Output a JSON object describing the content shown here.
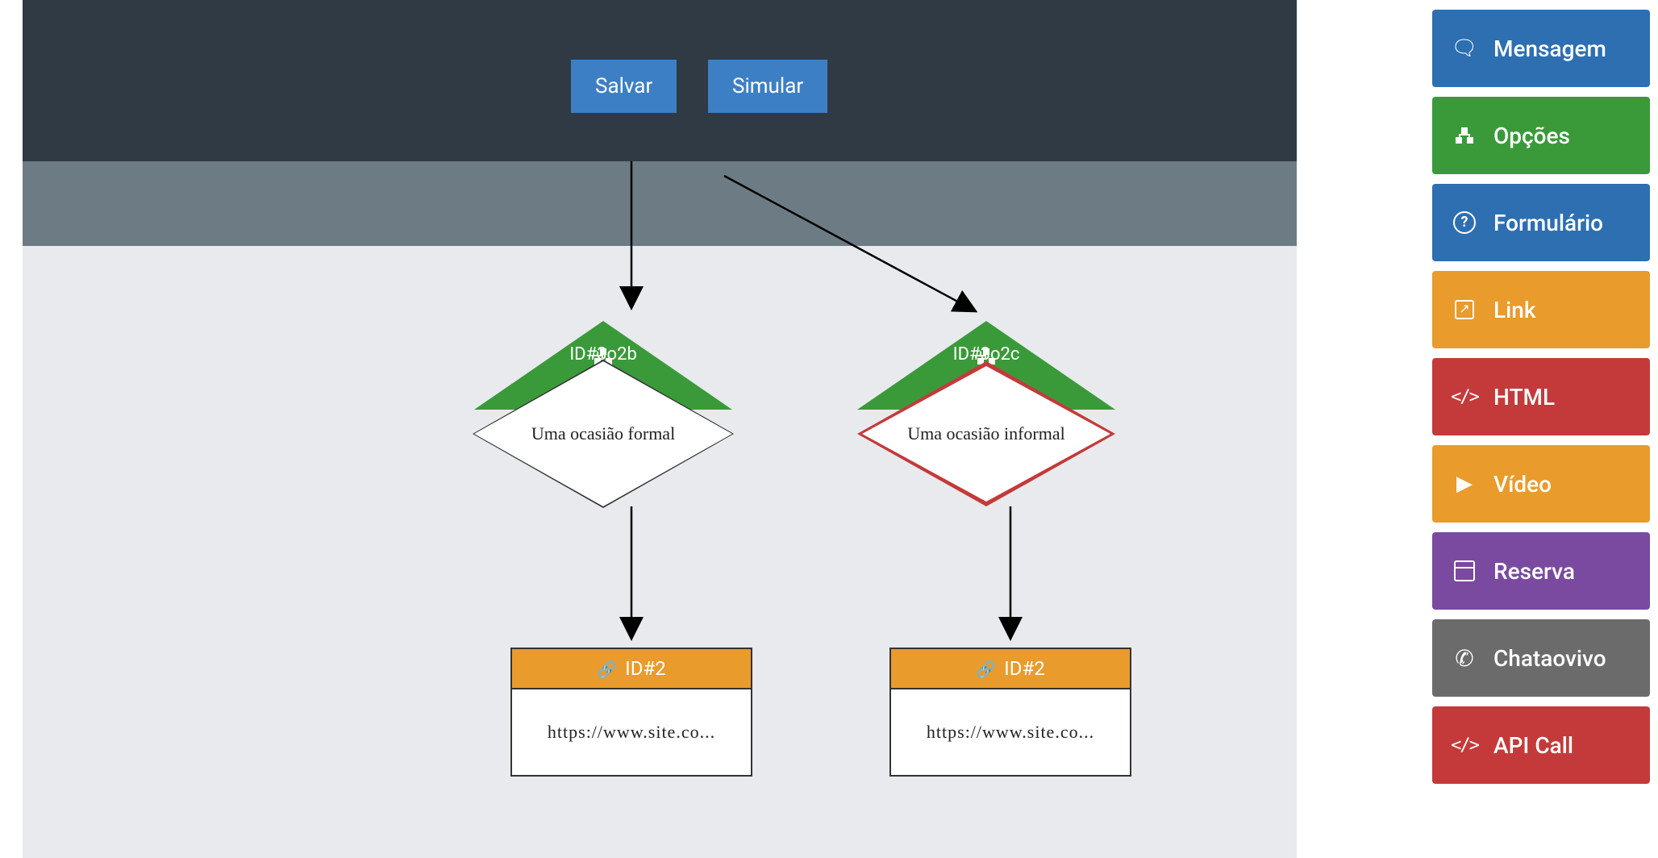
{
  "toolbar": {
    "save_label": "Salvar",
    "simulate_label": "Simular"
  },
  "nodes": {
    "option_left": {
      "id_label": "ID#3o2b",
      "text": "Uma ocasião formal"
    },
    "option_right": {
      "id_label": "ID#3o2c",
      "text": "Uma ocasião informal"
    },
    "link_left": {
      "id_label": "ID#2",
      "url": "https://www.site.co..."
    },
    "link_right": {
      "id_label": "ID#2",
      "url": "https://www.site.co..."
    }
  },
  "sidebar": {
    "items": [
      {
        "label": "Mensagem",
        "icon": "chat-icon",
        "color": "c-blue"
      },
      {
        "label": "Opções",
        "icon": "tree-icon",
        "color": "c-green"
      },
      {
        "label": "Formulário",
        "icon": "help-icon",
        "color": "c-blue"
      },
      {
        "label": "Link",
        "icon": "external-icon",
        "color": "c-orange"
      },
      {
        "label": "HTML",
        "icon": "code-icon",
        "color": "c-red"
      },
      {
        "label": "Vídeo",
        "icon": "play-icon",
        "color": "c-orange"
      },
      {
        "label": "Reserva",
        "icon": "calendar-icon",
        "color": "c-purple"
      },
      {
        "label": "Chataovivo",
        "icon": "phone-icon",
        "color": "c-gray"
      },
      {
        "label": "API Call",
        "icon": "code-icon",
        "color": "c-red"
      }
    ]
  }
}
